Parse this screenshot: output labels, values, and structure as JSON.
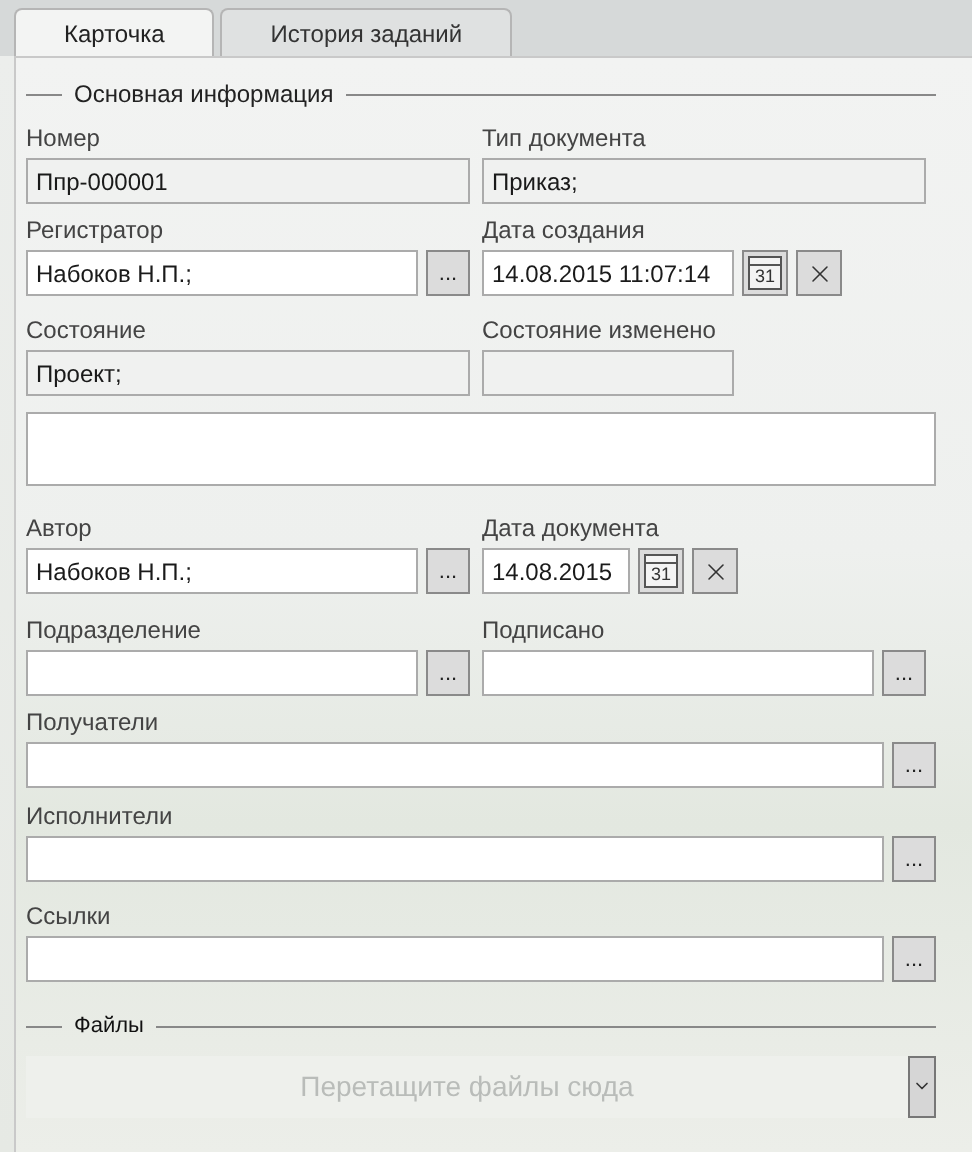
{
  "tabs": [
    {
      "label": "Карточка",
      "selected": true
    },
    {
      "label": "История заданий",
      "selected": false
    }
  ],
  "main_section": {
    "title": "Основная информация"
  },
  "rows": [
    {
      "fields": [
        {
          "kind": "text",
          "label": "Номер",
          "value": "Ппр-000001",
          "readonly": true
        },
        {
          "kind": "text",
          "label": "Тип документа",
          "value": "Приказ;",
          "readonly": true
        }
      ]
    },
    {
      "fields": [
        {
          "kind": "lookup",
          "label": "Регистратор",
          "value": "Набоков Н.П.;",
          "readonly": false,
          "button": "..."
        },
        {
          "kind": "datetime",
          "label": "Дата создания",
          "value": "14.08.2015  11:07:14",
          "readonly": false,
          "calendar_day": "31"
        }
      ]
    },
    {
      "fields": [
        {
          "kind": "text",
          "label": "Состояние",
          "value": "Проект;",
          "readonly": true
        },
        {
          "kind": "datetime",
          "label": "Состояние изменено",
          "readonly": true
        }
      ]
    },
    {
      "fields": [
        {
          "kind": "memo",
          "readonly": false
        }
      ]
    },
    {
      "fields": [
        {
          "kind": "lookup",
          "label": "Автор",
          "value": "Набоков Н.П.;",
          "readonly": false,
          "button": "..."
        },
        {
          "kind": "date",
          "label": "Дата документа",
          "value": "14.08.2015",
          "readonly": false,
          "calendar_day": "31"
        }
      ]
    },
    {
      "fields": [
        {
          "kind": "lookup",
          "label": "Подразделение",
          "readonly": false,
          "button": "..."
        },
        {
          "kind": "lookup",
          "label": "Подписано",
          "readonly": false,
          "button": "..."
        }
      ]
    },
    {
      "fields": [
        {
          "kind": "lookup",
          "label": "Получатели",
          "readonly": false,
          "button": "..."
        }
      ]
    },
    {
      "fields": [
        {
          "kind": "lookup",
          "label": "Исполнители",
          "readonly": false,
          "button": "..."
        }
      ]
    },
    {
      "fields": [
        {
          "kind": "lookup",
          "label": "Ссылки",
          "readonly": false,
          "button": "..."
        }
      ]
    }
  ],
  "files_section": {
    "title": "Файлы",
    "drop_hint": "Перетащите файлы сюда"
  }
}
